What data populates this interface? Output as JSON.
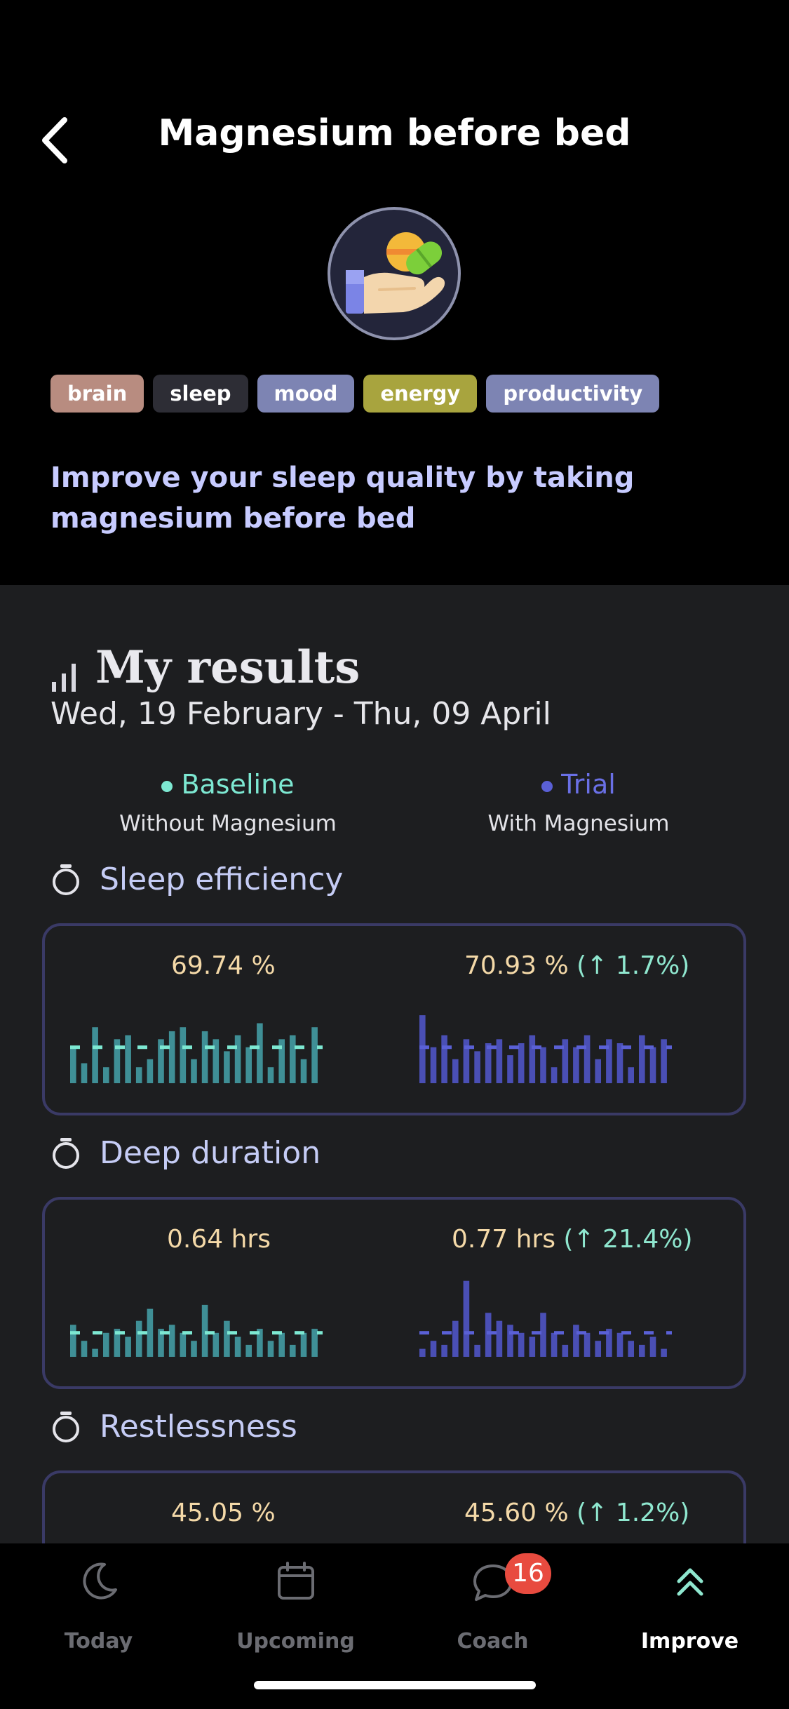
{
  "header": {
    "title": "Magnesium before bed",
    "tags": [
      {
        "label": "brain",
        "color": "#b88c80"
      },
      {
        "label": "sleep",
        "color": "#2d2d35"
      },
      {
        "label": "mood",
        "color": "#7d84b3"
      },
      {
        "label": "energy",
        "color": "#a8a43e"
      },
      {
        "label": "productivity",
        "color": "#7d84b3"
      }
    ],
    "description": "Improve your sleep quality by taking magnesium before bed"
  },
  "results": {
    "title": "My results",
    "date_range": "Wed, 19 February - Thu, 09 April",
    "baseline": {
      "label": "Baseline",
      "sub": "Without Magnesium",
      "color": "#7de8d2"
    },
    "trial": {
      "label": "Trial",
      "sub": "With Magnesium",
      "color": "#5a60d6"
    }
  },
  "metrics": [
    {
      "title": "Sleep efficiency",
      "baseline_value": "69.74 %",
      "trial_value": "70.93 %",
      "trial_change_open": " (",
      "trial_change": "↑ 1.7%",
      "trial_change_close": ")"
    },
    {
      "title": "Deep duration",
      "baseline_value": "0.64 hrs",
      "trial_value": "0.77 hrs",
      "trial_change_open": " (",
      "trial_change": "↑ 21.4%",
      "trial_change_close": ")"
    },
    {
      "title": "Restlessness",
      "baseline_value": "45.05 %",
      "trial_value": "45.60 %",
      "trial_change_open": " (",
      "trial_change": "↑ 1.2%",
      "trial_change_close": ")"
    }
  ],
  "chart_data": [
    {
      "type": "bar",
      "metric": "Sleep efficiency",
      "series": [
        {
          "name": "Baseline",
          "values": [
            0.45,
            0.25,
            0.7,
            0.2,
            0.55,
            0.6,
            0.2,
            0.3,
            0.55,
            0.65,
            0.7,
            0.3,
            0.65,
            0.55,
            0.4,
            0.6,
            0.45,
            0.75,
            0.2,
            0.55,
            0.6,
            0.3,
            0.7
          ],
          "mean": 0.45
        },
        {
          "name": "Trial",
          "values": [
            0.85,
            0.45,
            0.6,
            0.3,
            0.55,
            0.4,
            0.5,
            0.55,
            0.35,
            0.5,
            0.6,
            0.45,
            0.2,
            0.55,
            0.45,
            0.6,
            0.3,
            0.55,
            0.5,
            0.2,
            0.6,
            0.45,
            0.55
          ],
          "mean": 0.45
        }
      ]
    },
    {
      "type": "bar",
      "metric": "Deep duration",
      "series": [
        {
          "name": "Baseline",
          "values": [
            0.4,
            0.2,
            0.1,
            0.3,
            0.35,
            0.25,
            0.45,
            0.6,
            0.35,
            0.4,
            0.3,
            0.2,
            0.65,
            0.3,
            0.45,
            0.25,
            0.15,
            0.35,
            0.2,
            0.3,
            0.15,
            0.3,
            0.35
          ],
          "mean": 0.3
        },
        {
          "name": "Trial",
          "values": [
            0.1,
            0.2,
            0.15,
            0.45,
            0.95,
            0.15,
            0.55,
            0.45,
            0.4,
            0.3,
            0.25,
            0.55,
            0.3,
            0.15,
            0.4,
            0.3,
            0.2,
            0.35,
            0.3,
            0.2,
            0.15,
            0.25,
            0.1
          ],
          "mean": 0.3
        }
      ]
    }
  ],
  "tabbar": {
    "tabs": [
      {
        "label": "Today"
      },
      {
        "label": "Upcoming"
      },
      {
        "label": "Coach",
        "badge": "16"
      },
      {
        "label": "Improve"
      }
    ]
  }
}
